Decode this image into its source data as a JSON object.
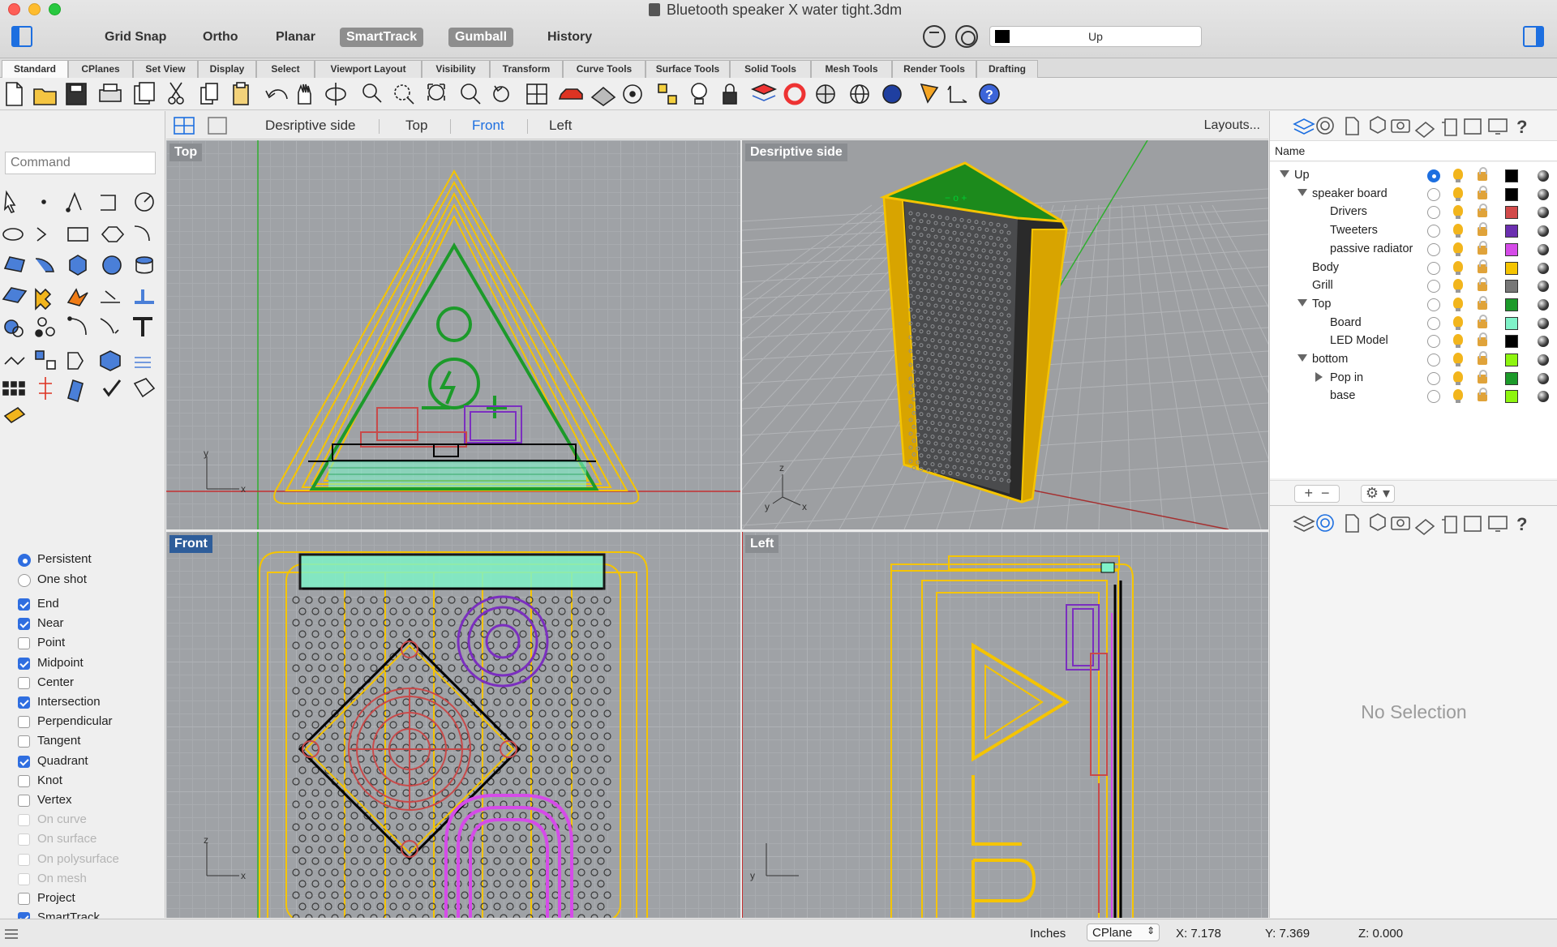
{
  "window": {
    "title": "Bluetooth speaker X water tight.3dm"
  },
  "modes": [
    {
      "label": "Grid Snap",
      "on": false
    },
    {
      "label": "Ortho",
      "on": false
    },
    {
      "label": "Planar",
      "on": false
    },
    {
      "label": "SmartTrack",
      "on": true
    },
    {
      "label": "Gumball",
      "on": true
    },
    {
      "label": "History",
      "on": false
    }
  ],
  "current_layer": {
    "name": "Up",
    "color": "#000000"
  },
  "tabs": [
    "Standard",
    "CPlanes",
    "Set View",
    "Display",
    "Select",
    "Viewport Layout",
    "Visibility",
    "Transform",
    "Curve Tools",
    "Surface Tools",
    "Solid Tools",
    "Mesh Tools",
    "Render Tools",
    "Drafting"
  ],
  "active_tab": "Standard",
  "command": {
    "placeholder": "Command"
  },
  "viewport_tabs": [
    "Desriptive side",
    "Top",
    "Front",
    "Left"
  ],
  "active_viewport_tab": "Front",
  "layouts_label": "Layouts...",
  "viewports": {
    "top": "Top",
    "persp": "Desriptive side",
    "front": "Front",
    "left": "Left"
  },
  "snaps": {
    "modes": [
      {
        "label": "Persistent",
        "checked": true
      },
      {
        "label": "One shot",
        "checked": false
      }
    ],
    "items": [
      {
        "label": "End",
        "checked": true,
        "enabled": true
      },
      {
        "label": "Near",
        "checked": true,
        "enabled": true
      },
      {
        "label": "Point",
        "checked": false,
        "enabled": true
      },
      {
        "label": "Midpoint",
        "checked": true,
        "enabled": true
      },
      {
        "label": "Center",
        "checked": false,
        "enabled": true
      },
      {
        "label": "Intersection",
        "checked": true,
        "enabled": true
      },
      {
        "label": "Perpendicular",
        "checked": false,
        "enabled": true
      },
      {
        "label": "Tangent",
        "checked": false,
        "enabled": true
      },
      {
        "label": "Quadrant",
        "checked": true,
        "enabled": true
      },
      {
        "label": "Knot",
        "checked": false,
        "enabled": true
      },
      {
        "label": "Vertex",
        "checked": false,
        "enabled": true
      },
      {
        "label": "On curve",
        "checked": false,
        "enabled": false
      },
      {
        "label": "On surface",
        "checked": false,
        "enabled": false
      },
      {
        "label": "On polysurface",
        "checked": false,
        "enabled": false
      },
      {
        "label": "On mesh",
        "checked": false,
        "enabled": false
      },
      {
        "label": "Project",
        "checked": false,
        "enabled": true
      },
      {
        "label": "SmartTrack",
        "checked": true,
        "enabled": true
      }
    ]
  },
  "layers": {
    "header": "Name",
    "rows": [
      {
        "name": "Up",
        "depth": 0,
        "expander": "open",
        "current": true,
        "color": "#000000"
      },
      {
        "name": "speaker board",
        "depth": 1,
        "expander": "open",
        "current": false,
        "color": "#000000"
      },
      {
        "name": "Drivers",
        "depth": 2,
        "expander": "none",
        "current": false,
        "color": "#d24a4a"
      },
      {
        "name": "Tweeters",
        "depth": 2,
        "expander": "none",
        "current": false,
        "color": "#6b2fb0"
      },
      {
        "name": "passive radiator",
        "depth": 2,
        "expander": "none",
        "current": false,
        "color": "#d54be8"
      },
      {
        "name": "Body",
        "depth": 1,
        "expander": "none",
        "current": false,
        "color": "#f5c400"
      },
      {
        "name": "Grill",
        "depth": 1,
        "expander": "none",
        "current": false,
        "color": "#777777"
      },
      {
        "name": "Top",
        "depth": 1,
        "expander": "open",
        "current": false,
        "color": "#1c9a2a"
      },
      {
        "name": "Board",
        "depth": 2,
        "expander": "none",
        "current": false,
        "color": "#7ff2c8"
      },
      {
        "name": "LED Model",
        "depth": 2,
        "expander": "none",
        "current": false,
        "color": "#000000"
      },
      {
        "name": "bottom",
        "depth": 1,
        "expander": "open",
        "current": false,
        "color": "#8ef50f"
      },
      {
        "name": "Pop in",
        "depth": 2,
        "expander": "closed",
        "current": false,
        "color": "#1c9a2a"
      },
      {
        "name": "base",
        "depth": 2,
        "expander": "none",
        "current": false,
        "color": "#8ef50f"
      }
    ]
  },
  "properties": {
    "empty_label": "No Selection"
  },
  "status": {
    "units": "Inches",
    "cplane": "CPlane",
    "x": "X: 7.178",
    "y": "Y: 7.369",
    "z": "Z: 0.000"
  }
}
